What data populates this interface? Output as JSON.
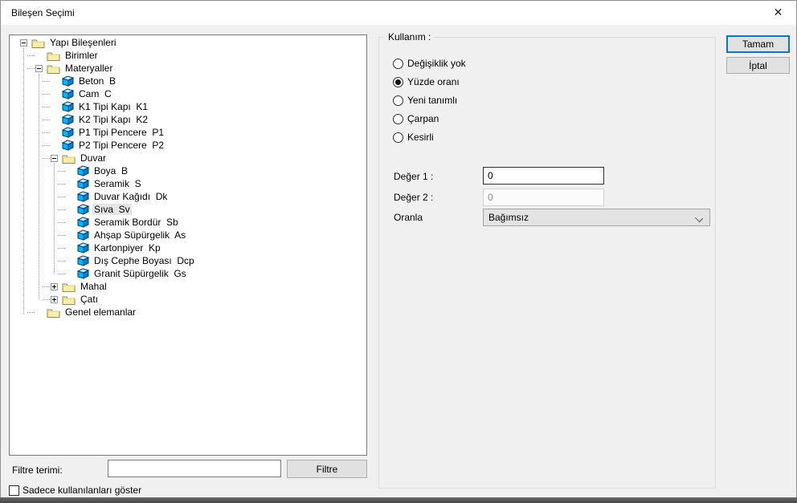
{
  "window": {
    "title": "Bileşen Seçimi",
    "close_icon": "✕"
  },
  "tree": {
    "items": [
      {
        "label": "Yapı Bileşenleri",
        "level": 0,
        "icon": "folder",
        "expander": "minus",
        "selected": false
      },
      {
        "label": "Birimler",
        "level": 1,
        "icon": "folder",
        "expander": "none",
        "selected": false
      },
      {
        "label": "Materyaller",
        "level": 1,
        "icon": "folder",
        "expander": "minus",
        "selected": false
      },
      {
        "label": "Beton  B",
        "level": 2,
        "icon": "material",
        "expander": "none",
        "selected": false
      },
      {
        "label": "Cam  C",
        "level": 2,
        "icon": "material",
        "expander": "none",
        "selected": false
      },
      {
        "label": "K1 Tipi Kapı  K1",
        "level": 2,
        "icon": "material",
        "expander": "none",
        "selected": false
      },
      {
        "label": "K2 Tipi Kapı  K2",
        "level": 2,
        "icon": "material",
        "expander": "none",
        "selected": false
      },
      {
        "label": "P1 Tipi Pencere  P1",
        "level": 2,
        "icon": "material",
        "expander": "none",
        "selected": false
      },
      {
        "label": "P2 Tipi Pencere  P2",
        "level": 2,
        "icon": "material",
        "expander": "none",
        "selected": false
      },
      {
        "label": "Duvar",
        "level": 2,
        "icon": "folder",
        "expander": "minus",
        "selected": false
      },
      {
        "label": "Boya  B",
        "level": 3,
        "icon": "material",
        "expander": "none",
        "selected": false
      },
      {
        "label": "Seramik  S",
        "level": 3,
        "icon": "material",
        "expander": "none",
        "selected": false
      },
      {
        "label": "Duvar Kağıdı  Dk",
        "level": 3,
        "icon": "material",
        "expander": "none",
        "selected": false
      },
      {
        "label": "Sıva  Sv",
        "level": 3,
        "icon": "material",
        "expander": "none",
        "selected": true
      },
      {
        "label": "Seramik Bordür  Sb",
        "level": 3,
        "icon": "material",
        "expander": "none",
        "selected": false
      },
      {
        "label": "Ahşap Süpürgelik  As",
        "level": 3,
        "icon": "material",
        "expander": "none",
        "selected": false
      },
      {
        "label": "Kartonpiyer  Kp",
        "level": 3,
        "icon": "material",
        "expander": "none",
        "selected": false
      },
      {
        "label": "Dış Cephe Boyası  Dcp",
        "level": 3,
        "icon": "material",
        "expander": "none",
        "selected": false
      },
      {
        "label": "Granit Süpürgelik  Gs",
        "level": 3,
        "icon": "material",
        "expander": "none",
        "selected": false
      },
      {
        "label": "Mahal",
        "level": 2,
        "icon": "folder",
        "expander": "plus",
        "selected": false
      },
      {
        "label": "Çatı",
        "level": 2,
        "icon": "folder",
        "expander": "plus",
        "selected": false
      },
      {
        "label": "Genel elemanlar",
        "level": 1,
        "icon": "folder",
        "expander": "none",
        "selected": false
      }
    ]
  },
  "filter": {
    "label": "Filtre terimi:",
    "input_value": "",
    "button_label": "Filtre"
  },
  "show_used_checkbox": {
    "label": "Sadece kullanılanları göster",
    "checked": false
  },
  "usage": {
    "group_label": "Kullanım :",
    "options": [
      {
        "label": "Değişiklik yok",
        "selected": false
      },
      {
        "label": "Yüzde oranı",
        "selected": true
      },
      {
        "label": "Yeni tanımlı",
        "selected": false
      },
      {
        "label": "Çarpan",
        "selected": false
      },
      {
        "label": "Kesirli",
        "selected": false
      }
    ],
    "deger1": {
      "label": "Değer 1 :",
      "value": "0",
      "enabled": true
    },
    "deger2": {
      "label": "Değer 2 :",
      "value": "0",
      "enabled": false
    },
    "oranla": {
      "label": "Oranla",
      "value": "Bağımsız"
    }
  },
  "buttons": {
    "ok": "Tamam",
    "cancel": "İptal"
  },
  "colors": {
    "accent_blue": "#0078d7",
    "titlebar_bg": "#ffffff",
    "body_bg": "#f0f0f0",
    "selection_gray": "#e5e5e5",
    "cube_cyan": "#00b6f0",
    "folder_yellow": "#f7efa6",
    "behind_strip": "#5a5a5a"
  }
}
